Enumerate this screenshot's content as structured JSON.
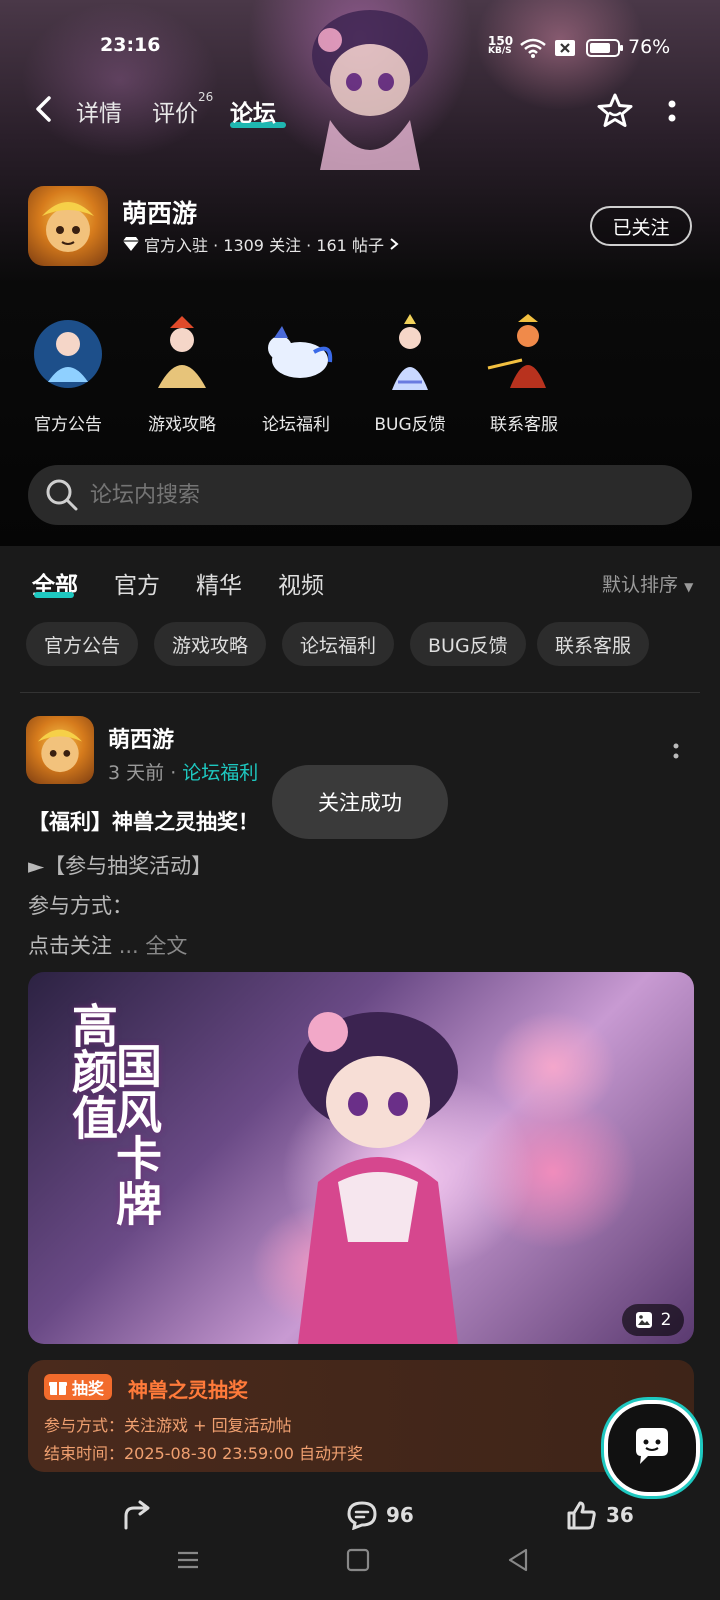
{
  "status_bar": {
    "time": "23:16",
    "net_speed_value": "150",
    "net_speed_unit": "KB/S",
    "battery": "76%"
  },
  "nav": {
    "tabs": [
      "详情",
      "评价",
      "论坛"
    ],
    "review_count": "26",
    "active_tab": "论坛"
  },
  "app": {
    "name": "萌西游",
    "meta": "官方入驻 · 1309 关注 · 161 帖子",
    "follow_label": "已关注"
  },
  "categories": [
    {
      "label": "官方公告"
    },
    {
      "label": "游戏攻略"
    },
    {
      "label": "论坛福利"
    },
    {
      "label": "BUG反馈"
    },
    {
      "label": "联系客服"
    }
  ],
  "search": {
    "placeholder": "论坛内搜索"
  },
  "feed_tabs": [
    "全部",
    "官方",
    "精华",
    "视频"
  ],
  "sort_label": "默认排序",
  "chips": [
    "官方公告",
    "游戏攻略",
    "论坛福利",
    "BUG反馈",
    "联系客服"
  ],
  "post": {
    "author": "萌西游",
    "time": "3 天前",
    "category": "论坛福利",
    "title": "【福利】神兽之灵抽奖！",
    "lines": [
      "►【参与抽奖活动】",
      "参与方式：",
      "点击关注"
    ],
    "more": "... 全文",
    "poster_text_1": "高颜值",
    "poster_text_2": "国风卡牌",
    "image_count": "2",
    "lottery": {
      "tag": "抽奖",
      "title": "神兽之灵抽奖",
      "method": "参与方式：关注游戏 + 回复活动帖",
      "end": "结束时间：2025-08-30 23:59:00 自动开奖"
    },
    "comments": "96",
    "likes": "36"
  },
  "toast": "关注成功",
  "colors": {
    "accent": "#1ec8c0",
    "lottery": "#ff7a3a"
  }
}
